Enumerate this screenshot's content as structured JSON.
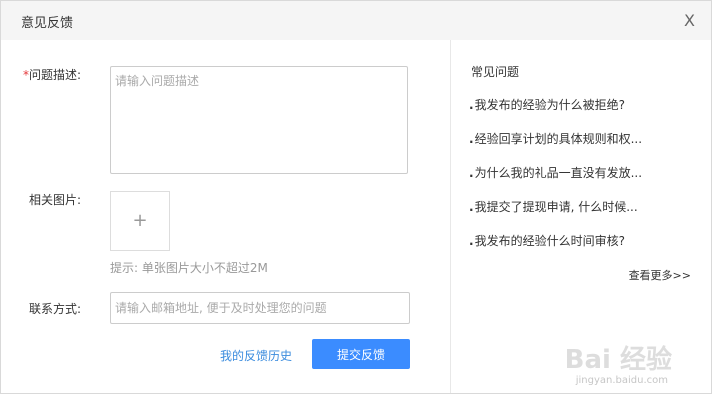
{
  "dialog": {
    "title": "意见反馈",
    "close_label": "X"
  },
  "form": {
    "description_required_mark": "*",
    "description_label": "问题描述:",
    "description_placeholder": "请输入问题描述",
    "description_value": "",
    "image_label": "相关图片:",
    "upload_icon": "+",
    "image_hint": "提示: 单张图片大小不超过2M",
    "contact_label": "联系方式:",
    "contact_placeholder": "请输入邮箱地址, 便于及时处理您的问题",
    "contact_value": "",
    "history_link": "我的反馈历史",
    "submit_label": "提交反馈"
  },
  "faq": {
    "title": "常见问题",
    "items": [
      {
        "bullet": ".",
        "text": "我发布的经验为什么被拒绝?"
      },
      {
        "bullet": ".",
        "text": "经验回享计划的具体规则和权..."
      },
      {
        "bullet": ".",
        "text": "为什么我的礼品一直没有发放..."
      },
      {
        "bullet": ".",
        "text": "我提交了提现申请, 什么时候..."
      },
      {
        "bullet": ".",
        "text": "我发布的经验什么时间审核?"
      }
    ],
    "more_label": "查看更多>>"
  },
  "watermark": {
    "logo_text": "Bai 经验",
    "url": "jingyan.baidu.com"
  },
  "colors": {
    "accent": "#3b8cff",
    "link": "#3b8cde",
    "required": "#e4393c"
  }
}
